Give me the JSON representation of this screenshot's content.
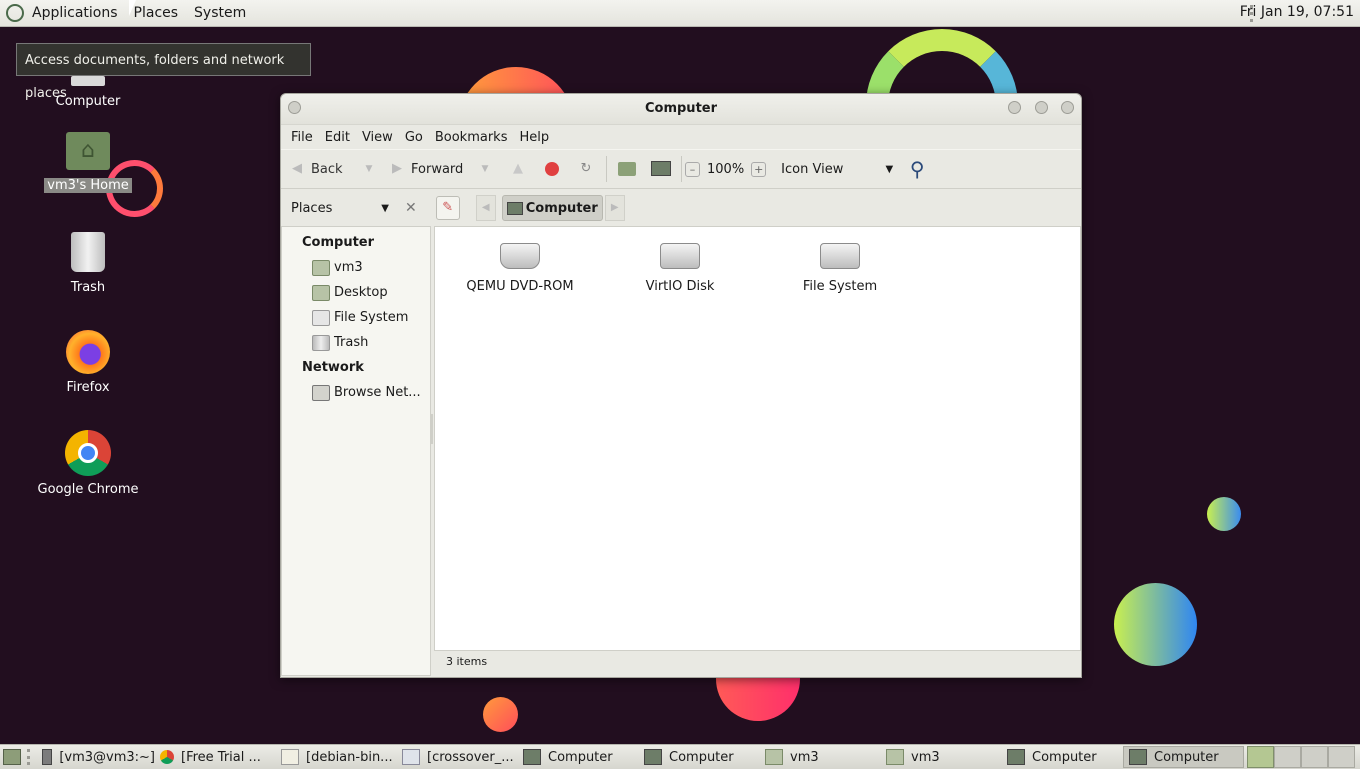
{
  "top_panel": {
    "menus": [
      "Applications",
      "Places",
      "System"
    ],
    "clock": "Fri Jan 19, 07:51"
  },
  "tooltip": "Access documents, folders and network places",
  "desktop_icons": [
    {
      "label": "Computer",
      "icon": "computer-icon"
    },
    {
      "label": "vm3's Home",
      "icon": "home-folder-icon"
    },
    {
      "label": "Trash",
      "icon": "trash-icon"
    },
    {
      "label": "Firefox",
      "icon": "firefox-icon"
    },
    {
      "label": "Google Chrome",
      "icon": "chrome-icon"
    }
  ],
  "window": {
    "title": "Computer",
    "menus": [
      "File",
      "Edit",
      "View",
      "Go",
      "Bookmarks",
      "Help"
    ],
    "toolbar": {
      "back": "Back",
      "forward": "Forward",
      "zoom": "100%",
      "view_mode": "Icon View"
    },
    "sidebar_selector": "Places",
    "location": "Computer",
    "places": {
      "computer_header": "Computer",
      "computer_items": [
        "vm3",
        "Desktop",
        "File System",
        "Trash"
      ],
      "network_header": "Network",
      "network_items": [
        "Browse Net..."
      ]
    },
    "files": [
      "QEMU DVD-ROM",
      "VirtIO Disk",
      "File System"
    ],
    "status": "3 items"
  },
  "taskbar": {
    "tasks": [
      {
        "label": "[vm3@vm3:~]",
        "icon": "terminal-icon"
      },
      {
        "label": "[Free Trial ...",
        "icon": "chrome-icon"
      },
      {
        "label": "[debian-bin...",
        "icon": "text-editor-icon"
      },
      {
        "label": "[crossover_...",
        "icon": "file-icon"
      },
      {
        "label": "Computer",
        "icon": "computer-icon"
      },
      {
        "label": "Computer",
        "icon": "computer-icon"
      },
      {
        "label": "vm3",
        "icon": "folder-icon"
      },
      {
        "label": "vm3",
        "icon": "folder-icon"
      },
      {
        "label": "Computer",
        "icon": "computer-icon"
      },
      {
        "label": "Computer",
        "icon": "computer-icon"
      }
    ]
  },
  "colors": {
    "desktop_bg": "#220e1f",
    "panel_bg": "#e8e8e2",
    "accent_green": "#8a9a6a"
  }
}
